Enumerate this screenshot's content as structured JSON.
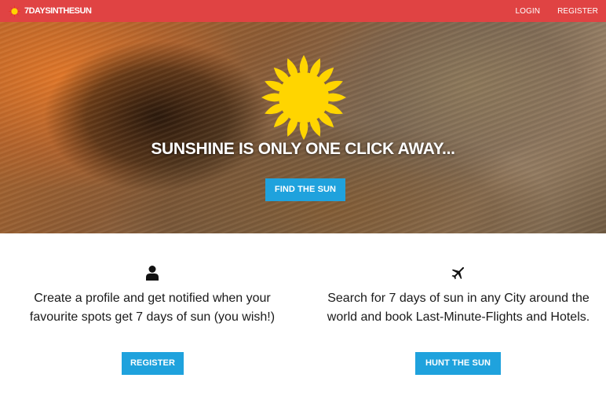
{
  "navbar": {
    "brand_text": "7DAYSINTHESUN",
    "brand_icon": "sun-icon",
    "links": [
      {
        "label": "LOGIN"
      },
      {
        "label": "REGISTER"
      }
    ],
    "background_color": "#e04343"
  },
  "hero": {
    "icon": "sun-icon",
    "headline": "SUNSHINE IS ONLY ONE CLICK AWAY...",
    "cta_label": "FIND THE SUN"
  },
  "features": [
    {
      "icon": "user-icon",
      "text": "Create a profile and get notified when your favourite spots get 7 days of sun (you wish!)",
      "button_label": "REGISTER"
    },
    {
      "icon": "airplane-icon",
      "text": "Search for 7 days of sun in any City around the world and book Last-Minute-Flights and Hotels.",
      "button_label": "HUNT THE SUN"
    }
  ],
  "colors": {
    "accent_button": "#1fa2dd",
    "sun_yellow": "#ffd500",
    "sun_rays": "#e8301c"
  }
}
